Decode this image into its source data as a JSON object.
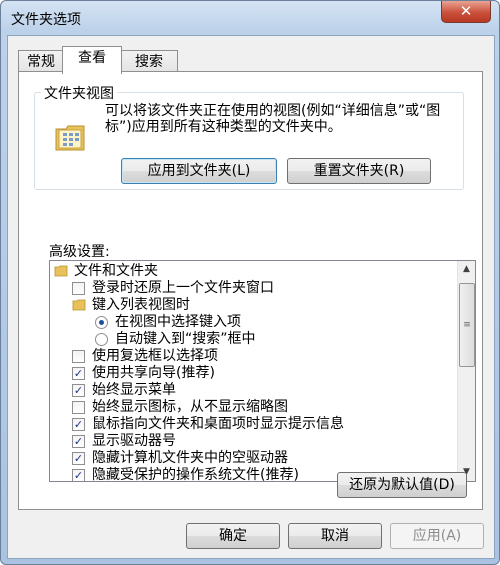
{
  "window": {
    "title": "文件夹选项",
    "close_glyph": "✕"
  },
  "tabs": [
    {
      "label": "常规"
    },
    {
      "label": "查看"
    },
    {
      "label": "搜索"
    }
  ],
  "folder_views": {
    "legend": "文件夹视图",
    "description": "可以将该文件夹正在使用的视图(例如“详细信息”或“图标”)应用到所有这种类型的文件夹中。",
    "apply_button": "应用到文件夹(L)",
    "reset_button": "重置文件夹(R)"
  },
  "advanced": {
    "label": "高级设置:",
    "items": [
      {
        "type": "folder",
        "label": "文件和文件夹"
      },
      {
        "type": "checkbox",
        "checked": false,
        "label": "登录时还原上一个文件夹窗口"
      },
      {
        "type": "folder",
        "label": "键入列表视图时"
      },
      {
        "type": "radio",
        "checked": true,
        "label": "在视图中选择键入项"
      },
      {
        "type": "radio",
        "checked": false,
        "label": "自动键入到“搜索”框中"
      },
      {
        "type": "checkbox",
        "checked": false,
        "label": "使用复选框以选择项"
      },
      {
        "type": "checkbox",
        "checked": true,
        "label": "使用共享向导(推荐)"
      },
      {
        "type": "checkbox",
        "checked": true,
        "label": "始终显示菜单"
      },
      {
        "type": "checkbox",
        "checked": false,
        "label": "始终显示图标，从不显示缩略图"
      },
      {
        "type": "checkbox",
        "checked": true,
        "label": "鼠标指向文件夹和桌面项时显示提示信息"
      },
      {
        "type": "checkbox",
        "checked": true,
        "label": "显示驱动器号"
      },
      {
        "type": "checkbox",
        "checked": true,
        "label": "隐藏计算机文件夹中的空驱动器"
      },
      {
        "type": "checkbox",
        "checked": true,
        "label": "隐藏受保护的操作系统文件(推荐)"
      }
    ],
    "restore_defaults_button": "还原为默认值(D)"
  },
  "footer": {
    "ok": "确定",
    "cancel": "取消",
    "apply": "应用(A)"
  },
  "icons": {
    "check": "✓",
    "scroll_up": "▲",
    "scroll_down": "▼",
    "grip": "≡"
  },
  "colors": {
    "title_gradient_top": "#d4e3f3",
    "close_red": "#c9503a",
    "folder_yellow": "#e8c15a"
  }
}
